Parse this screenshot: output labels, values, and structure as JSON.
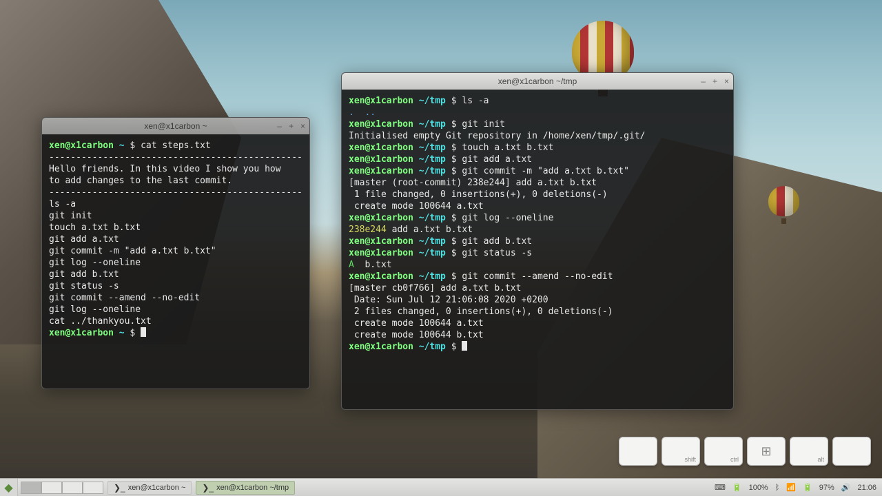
{
  "term_left": {
    "title": "xen@x1carbon ~",
    "prompt_user": "xen@x1carbon",
    "prompt_path": "~",
    "cmd0": "cat steps.txt",
    "sep": "-----------------------------------------------",
    "intro1": "Hello friends. In this video I show you how",
    "intro2": "to add changes to the last commit.",
    "steps": [
      "ls -a",
      "git init",
      "touch a.txt b.txt",
      "git add a.txt",
      "git commit -m \"add a.txt b.txt\"",
      "git log --oneline",
      "git add b.txt",
      "git status -s",
      "git commit --amend --no-edit",
      "git log --oneline",
      "cat ../thankyou.txt"
    ]
  },
  "term_right": {
    "title": "xen@x1carbon ~/tmp",
    "prompt_user": "xen@x1carbon",
    "prompt_path": "~/tmp",
    "l1_cmd": "ls -a",
    "l1_out": ".  ..",
    "l2_cmd": "git init",
    "l2_out": "Initialised empty Git repository in /home/xen/tmp/.git/",
    "l3_cmd": "touch a.txt b.txt",
    "l4_cmd": "git add a.txt",
    "l5_cmd": "git commit -m \"add a.txt b.txt\"",
    "l5_out1": "[master (root-commit) 238e244] add a.txt b.txt",
    "l5_out2": " 1 file changed, 0 insertions(+), 0 deletions(-)",
    "l5_out3": " create mode 100644 a.txt",
    "l6_cmd": "git log --oneline",
    "l6_hash": "238e244",
    "l6_msg": " add a.txt b.txt",
    "l7_cmd": "git add b.txt",
    "l8_cmd": "git status -s",
    "l8_a": "A",
    "l8_file": "  b.txt",
    "l9_cmd": "git commit --amend --no-edit",
    "l9_out1": "[master cb0f766] add a.txt b.txt",
    "l9_out2": " Date: Sun Jul 12 21:06:08 2020 +0200",
    "l9_out3": " 2 files changed, 0 insertions(+), 0 deletions(-)",
    "l9_out4": " create mode 100644 a.txt",
    "l9_out5": " create mode 100644 b.txt"
  },
  "keycast": {
    "k_shift": "shift",
    "k_ctrl": "ctrl",
    "k_win": "⊞",
    "k_alt": "alt"
  },
  "panel": {
    "task1": "xen@x1carbon ~",
    "task2": "xen@x1carbon ~/tmp",
    "battery": "100%",
    "battery2": "97%",
    "clock": "21:06"
  }
}
